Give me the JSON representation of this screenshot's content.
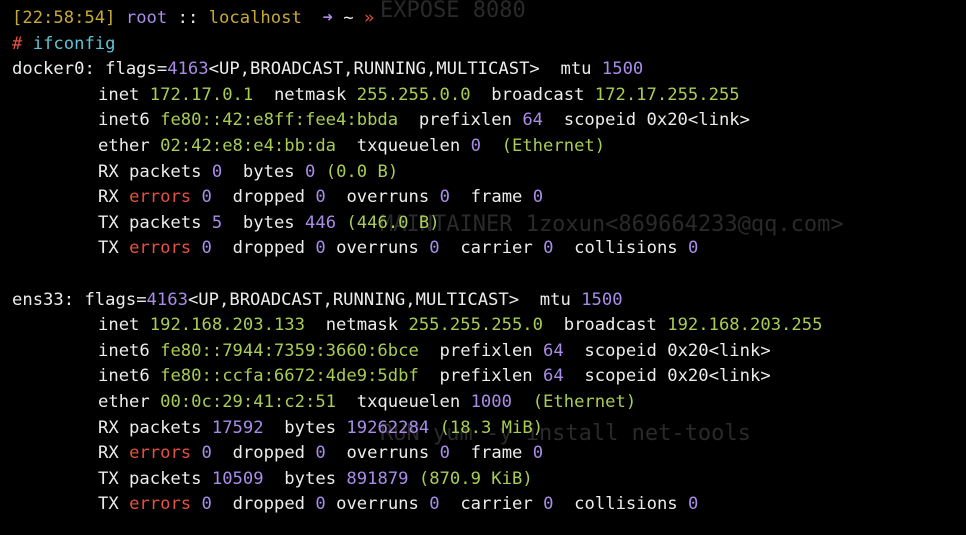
{
  "colors": {
    "background": "#000000",
    "text": "#ececec",
    "number": "#a98ce8",
    "address": "#a8cc54",
    "error": "#e2523f",
    "command": "#5fc3d3",
    "time": "#c7a934"
  },
  "icons": {
    "arrow": "➜",
    "chevron": "»"
  },
  "watermark": {
    "line1": "EXPOSE 8080",
    "line2": "MAINTAINER 1zoxun<869664233@qq.com>",
    "line3": "RUN yum -y install net-tools"
  },
  "prompt": {
    "time": "[22:58:54]",
    "user": "root",
    "separator": "::",
    "host": "localhost",
    "arrow": "➜",
    "dir": "~",
    "chevron": "»"
  },
  "command": {
    "hash": "#",
    "text": "ifconfig"
  },
  "interfaces": [
    {
      "name": "docker0",
      "flags_label": "flags=",
      "flags_value": "4163",
      "flags_list": "<UP,BROADCAST,RUNNING,MULTICAST>",
      "mtu_label": "mtu",
      "mtu_value": "1500",
      "inet_label": "inet",
      "inet_addr": "172.17.0.1",
      "netmask_label": "netmask",
      "netmask": "255.255.0.0",
      "broadcast_label": "broadcast",
      "broadcast": "172.17.255.255",
      "inet6": [
        {
          "label": "inet6",
          "addr": "fe80::42:e8ff:fee4:bbda",
          "prefixlen_label": "prefixlen",
          "prefixlen": "64",
          "scopeid_label": "scopeid",
          "scopeid": "0x20<link>"
        }
      ],
      "ether_label": "ether",
      "ether": "02:42:e8:e4:bb:da",
      "txqueuelen_label": "txqueuelen",
      "txqueuelen": "0",
      "link_type": "(Ethernet)",
      "rx_packets_label": "RX packets",
      "rx_packets": "0",
      "rx_bytes_label": "bytes",
      "rx_bytes": "0",
      "rx_human": "(0.0 B)",
      "rx_errors_prefix": "RX",
      "errors_label": "errors",
      "rx_errors": "0",
      "dropped_label": "dropped",
      "rx_dropped": "0",
      "overruns_label": "overruns",
      "rx_overruns": "0",
      "frame_label": "frame",
      "rx_frame": "0",
      "tx_packets_label": "TX packets",
      "tx_packets": "5",
      "tx_bytes_label": "bytes",
      "tx_bytes": "446",
      "tx_human": "(446.0 B)",
      "tx_errors_prefix": "TX",
      "tx_errors": "0",
      "tx_dropped": "0",
      "tx_overruns": "0",
      "carrier_label": "carrier",
      "tx_carrier": "0",
      "collisions_label": "collisions",
      "tx_collisions": "0"
    },
    {
      "name": "ens33",
      "flags_label": "flags=",
      "flags_value": "4163",
      "flags_list": "<UP,BROADCAST,RUNNING,MULTICAST>",
      "mtu_label": "mtu",
      "mtu_value": "1500",
      "inet_label": "inet",
      "inet_addr": "192.168.203.133",
      "netmask_label": "netmask",
      "netmask": "255.255.255.0",
      "broadcast_label": "broadcast",
      "broadcast": "192.168.203.255",
      "inet6": [
        {
          "label": "inet6",
          "addr": "fe80::7944:7359:3660:6bce",
          "prefixlen_label": "prefixlen",
          "prefixlen": "64",
          "scopeid_label": "scopeid",
          "scopeid": "0x20<link>"
        },
        {
          "label": "inet6",
          "addr": "fe80::ccfa:6672:4de9:5dbf",
          "prefixlen_label": "prefixlen",
          "prefixlen": "64",
          "scopeid_label": "scopeid",
          "scopeid": "0x20<link>"
        }
      ],
      "ether_label": "ether",
      "ether": "00:0c:29:41:c2:51",
      "txqueuelen_label": "txqueuelen",
      "txqueuelen": "1000",
      "link_type": "(Ethernet)",
      "rx_packets_label": "RX packets",
      "rx_packets": "17592",
      "rx_bytes_label": "bytes",
      "rx_bytes": "19262284",
      "rx_human": "(18.3 MiB)",
      "rx_errors_prefix": "RX",
      "errors_label": "errors",
      "rx_errors": "0",
      "dropped_label": "dropped",
      "rx_dropped": "0",
      "overruns_label": "overruns",
      "rx_overruns": "0",
      "frame_label": "frame",
      "rx_frame": "0",
      "tx_packets_label": "TX packets",
      "tx_packets": "10509",
      "tx_bytes_label": "bytes",
      "tx_bytes": "891879",
      "tx_human": "(870.9 KiB)",
      "tx_errors_prefix": "TX",
      "tx_errors": "0",
      "tx_dropped": "0",
      "tx_overruns": "0",
      "carrier_label": "carrier",
      "tx_carrier": "0",
      "collisions_label": "collisions",
      "tx_collisions": "0"
    }
  ]
}
